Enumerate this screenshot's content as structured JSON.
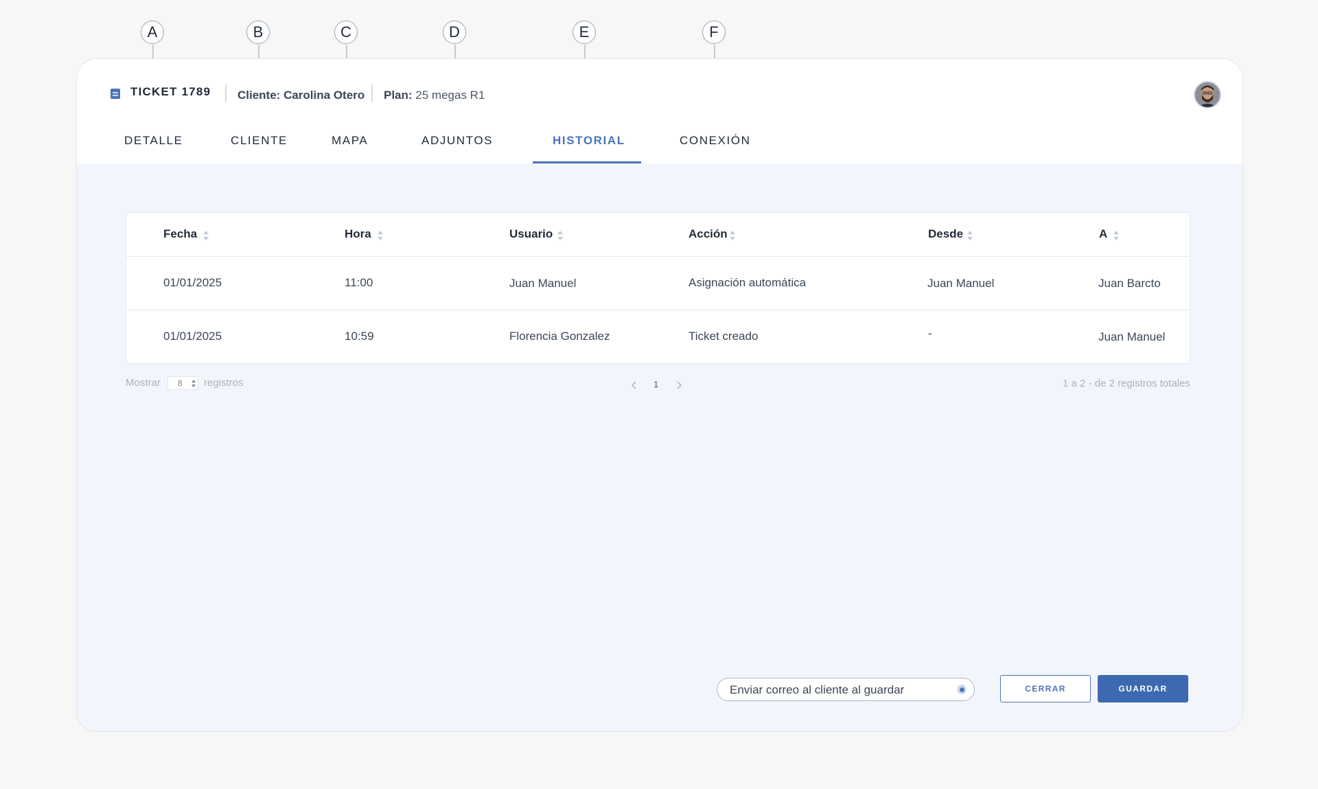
{
  "callouts": [
    "A",
    "B",
    "C",
    "D",
    "E",
    "F"
  ],
  "header": {
    "ticket_title": "TICKET 1789",
    "client_label": "Cliente:",
    "client_value": "Carolina Otero",
    "plan_label": "Plan:",
    "plan_value": "25 megas R1"
  },
  "tabs": [
    {
      "label": "DETALLE"
    },
    {
      "label": "CLIENTE"
    },
    {
      "label": "MAPA"
    },
    {
      "label": "ADJUNTOS"
    },
    {
      "label": "HISTORIAL",
      "active": true
    },
    {
      "label": "CONEXIÓN"
    }
  ],
  "table": {
    "columns": [
      "Fecha",
      "Hora",
      "Usuario",
      "Acción",
      "Desde",
      "A"
    ],
    "rows": [
      [
        "01/01/2025",
        "11:00",
        "Juan Manuel",
        "Asignación automática",
        "Juan Manuel",
        "Juan Barcto"
      ],
      [
        "01/01/2025",
        "10:59",
        "Florencia Gonzalez",
        "Ticket creado",
        "-",
        "Juan Manuel"
      ]
    ]
  },
  "pagination": {
    "show_label": "Mostrar",
    "per_page": "8",
    "records_label": "registros",
    "current_page": "1",
    "totals": "1 a 2 - de 2 registros totales"
  },
  "actions": {
    "email_toggle_label": "Enviar correo al cliente al guardar",
    "email_toggle_checked": true,
    "close_label": "CERRAR",
    "save_label": "GUARDAR"
  },
  "colors": {
    "accent": "#4a74b8",
    "primary_button": "#3d69b0",
    "content_bg": "#f2f6fc",
    "page_bg": "#f7f7f7"
  },
  "icons": {
    "ticket": "ticket-icon",
    "sort": "sort-icon",
    "prev": "chevron-left-icon",
    "next": "chevron-right-icon"
  }
}
